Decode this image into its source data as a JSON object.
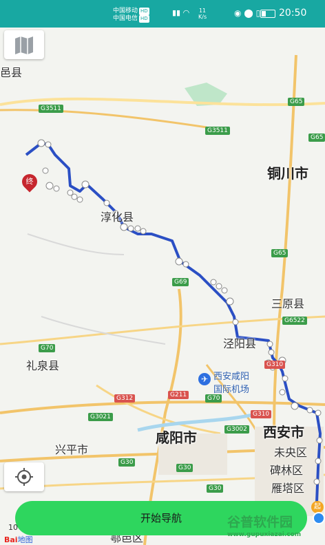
{
  "status_bar": {
    "carrier1": "中国移动",
    "carrier2": "中国电信",
    "hd": "HD",
    "signal_label": "5G 4G",
    "speed_value": "11",
    "speed_unit": "K/s",
    "battery_label": "",
    "time": "20:50"
  },
  "map": {
    "cities": [
      {
        "name": "铜川市"
      },
      {
        "name": "淳化县"
      },
      {
        "name": "泾阳县"
      },
      {
        "name": "三原县"
      },
      {
        "name": "礼泉县"
      },
      {
        "name": "兴平市"
      },
      {
        "name": "咸阳市"
      },
      {
        "name": "西安市"
      },
      {
        "name": "未央区"
      },
      {
        "name": "碑林区"
      },
      {
        "name": "雁塔区"
      },
      {
        "name": "鄠邑区"
      },
      {
        "name": "邑县"
      }
    ],
    "highways": [
      "G3511",
      "G3511",
      "G65",
      "G65",
      "G69",
      "G6522",
      "G70",
      "G65",
      "G310",
      "G312",
      "G211",
      "G70",
      "G3021",
      "G3002",
      "G310",
      "G30",
      "G30",
      "G30"
    ],
    "airport": "西安咸阳国际机场",
    "airport_line1": "西安咸阳",
    "airport_line2": "国际机场",
    "start_marker": "起",
    "end_marker": "终"
  },
  "controls": {
    "start_navigation": "开始导航",
    "scale_text": "10"
  },
  "branding": {
    "baidu_b": "Bai",
    "baidu_d": "地图",
    "watermark_title": "谷普软件园",
    "watermark_url": "www.gupuxiazai.com"
  },
  "colors": {
    "status_bar": "#18a8a2",
    "route": "#2b4fc4",
    "nav_button": "#2ed65e"
  }
}
